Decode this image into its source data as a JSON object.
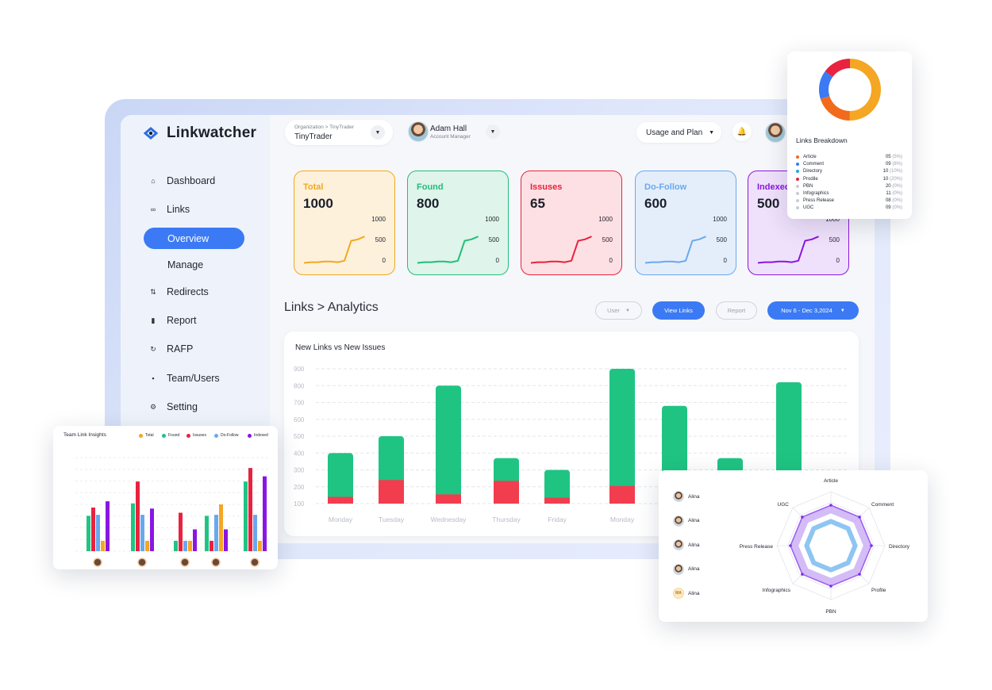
{
  "app": {
    "name": "Linkwatcher"
  },
  "sidebar": {
    "items": [
      {
        "label": "Dashboard",
        "icon": "home-icon"
      },
      {
        "label": "Links",
        "icon": "link-icon"
      },
      {
        "label": "Redirects",
        "icon": "arrows-updown-icon"
      },
      {
        "label": "Report",
        "icon": "document-icon"
      },
      {
        "label": "RAFP",
        "icon": "refresh-icon"
      },
      {
        "label": "Team/Users",
        "icon": "users-icon"
      },
      {
        "label": "Setting",
        "icon": "gear-icon"
      }
    ],
    "links_sub": [
      {
        "label": "Overview",
        "active": true
      },
      {
        "label": "Manage",
        "active": false
      }
    ]
  },
  "header": {
    "org_breadcrumb": "Organization > TinyTrader",
    "org_name": "TinyTrader",
    "user_name": "Adam Hall",
    "user_role": "Account Manager",
    "usage_label": "Usage and Plan"
  },
  "stats": [
    {
      "label": "Total",
      "value": "1000",
      "ticks": [
        "1000",
        "500",
        "0"
      ],
      "color": "#f2a81d",
      "bg": "#fdf1dc",
      "trend": [
        0.05,
        0.06,
        0.06,
        0.07,
        0.07,
        0.06,
        0.08,
        0.36,
        0.38,
        0.42
      ]
    },
    {
      "label": "Found",
      "value": "800",
      "ticks": [
        "1000",
        "500",
        "0"
      ],
      "color": "#1fbf7a",
      "bg": "#dff4ea",
      "trend": [
        0.05,
        0.06,
        0.06,
        0.07,
        0.07,
        0.06,
        0.08,
        0.36,
        0.38,
        0.42
      ]
    },
    {
      "label": "Issuses",
      "value": "65",
      "ticks": [
        "1000",
        "500",
        "0"
      ],
      "color": "#e8223f",
      "bg": "#fde0e3",
      "trend": [
        0.05,
        0.06,
        0.06,
        0.07,
        0.07,
        0.06,
        0.08,
        0.36,
        0.38,
        0.42
      ]
    },
    {
      "label": "Do-Follow",
      "value": "600",
      "ticks": [
        "1000",
        "500",
        "0"
      ],
      "color": "#6aa8ec",
      "bg": "#e4eefb",
      "trend": [
        0.05,
        0.06,
        0.06,
        0.07,
        0.07,
        0.06,
        0.08,
        0.36,
        0.38,
        0.42
      ]
    },
    {
      "label": "Indexed",
      "value": "500",
      "ticks": [
        "1000",
        "500",
        "0"
      ],
      "color": "#8a16e3",
      "bg": "#efe1fb",
      "trend": [
        0.05,
        0.06,
        0.06,
        0.07,
        0.07,
        0.06,
        0.08,
        0.36,
        0.38,
        0.42
      ]
    }
  ],
  "analytics": {
    "title": "Links > Analytics",
    "user_filter": "User",
    "view_links": "View Links",
    "report": "Report",
    "date_range": "Nov 6 - Dec 3,2024"
  },
  "chart_data": [
    {
      "type": "bar",
      "title": "New Links vs New Issues",
      "categories": [
        "Monday",
        "Tuesday",
        "Wednesday",
        "Thursday",
        "Friday",
        "Monday",
        "",
        "",
        ""
      ],
      "yticks": [
        900,
        800,
        700,
        600,
        500,
        400,
        300,
        200,
        100
      ],
      "ylim": [
        100,
        900
      ],
      "series": [
        {
          "color": "#1fc483",
          "values": [
            400,
            500,
            800,
            370,
            300,
            900,
            680,
            370,
            820
          ]
        },
        {
          "color": "#f23d4f",
          "values": [
            140,
            240,
            155,
            235,
            135,
            205,
            0,
            0,
            0
          ]
        }
      ],
      "grid": true
    },
    {
      "type": "pie",
      "title": "Links Breakdown",
      "slices": [
        {
          "name": "Article",
          "value": "05",
          "pct": "(5%)",
          "color": "#f26a1b"
        },
        {
          "name": "Comment",
          "value": "09",
          "pct": "(8%)",
          "color": "#3b7af4"
        },
        {
          "name": "Directory",
          "value": "10",
          "pct": "(10%)",
          "color": "#20a7e0"
        },
        {
          "name": "Prodile",
          "value": "10",
          "pct": "(20%)",
          "color": "#e8223f"
        },
        {
          "name": "PBN",
          "value": "20",
          "pct": "(0%)",
          "color": "#c8ccd3"
        },
        {
          "name": "Infographics",
          "value": "11",
          "pct": "(0%)",
          "color": "#c8ccd3"
        },
        {
          "name": "Press Release",
          "value": "08",
          "pct": "(0%)",
          "color": "#c8ccd3"
        },
        {
          "name": "UGC",
          "value": "09",
          "pct": "(0%)",
          "color": "#c8ccd3"
        }
      ],
      "donut_colors": [
        "#f5a623",
        "#f26a1b",
        "#3b7af4",
        "#e8223f"
      ]
    },
    {
      "type": "bar",
      "title": "Team Link Insights",
      "legend": [
        {
          "name": "Total",
          "color": "#f5a623"
        },
        {
          "name": "Found",
          "color": "#1fc483"
        },
        {
          "name": "Issuses",
          "color": "#e8223f"
        },
        {
          "name": "Do-Follow",
          "color": "#6aa8ec"
        },
        {
          "name": "Indexed",
          "color": "#8a16e3"
        }
      ],
      "groups": [
        [
          100,
          340,
          420,
          350,
          480
        ],
        [
          100,
          460,
          670,
          350,
          410
        ],
        [
          100,
          100,
          370,
          100,
          210
        ],
        [
          450,
          340,
          100,
          350,
          210
        ],
        [
          100,
          670,
          800,
          350,
          720
        ]
      ],
      "ylim": [
        0,
        900
      ]
    },
    {
      "type": "radar",
      "axes": [
        "Article",
        "Comment",
        "Directory",
        "Profile",
        "PBN",
        "Infographics",
        "Press Release",
        "UGC"
      ],
      "series": [
        {
          "color": "#9b5cf0",
          "values": [
            0.75,
            0.75,
            0.75,
            0.75,
            0.75,
            0.75,
            0.75,
            0.75
          ]
        },
        {
          "color": "#8ec5f2",
          "values": [
            0.45,
            0.45,
            0.45,
            0.45,
            0.45,
            0.45,
            0.45,
            0.45
          ]
        }
      ],
      "users": [
        {
          "name": "Alina",
          "initials": ""
        },
        {
          "name": "Alina",
          "initials": ""
        },
        {
          "name": "Alina",
          "initials": ""
        },
        {
          "name": "Alina",
          "initials": ""
        },
        {
          "name": "Alina",
          "initials": "MA"
        }
      ]
    }
  ]
}
